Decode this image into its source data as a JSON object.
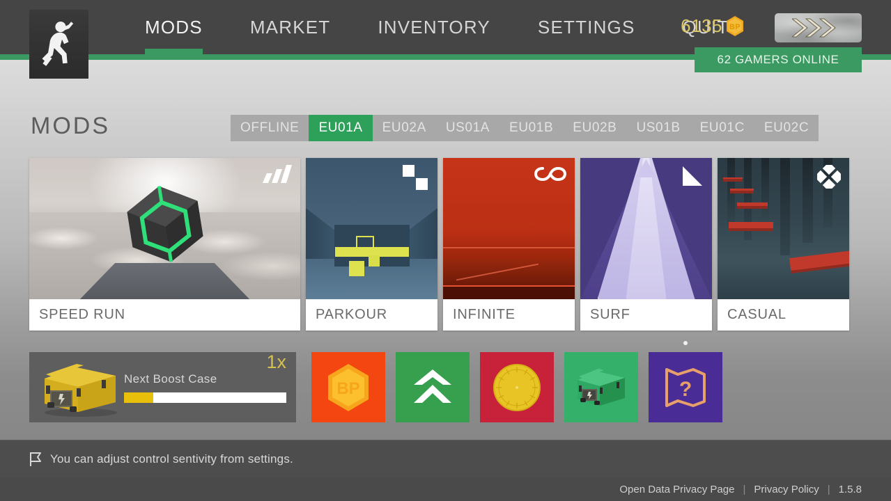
{
  "header": {
    "logo_icon": "running-man-logo",
    "nav": [
      {
        "label": "MODS",
        "active": true
      },
      {
        "label": "MARKET",
        "active": false
      },
      {
        "label": "INVENTORY",
        "active": false
      },
      {
        "label": "SETTINGS",
        "active": false
      },
      {
        "label": "QUIT",
        "active": false
      }
    ],
    "currency": {
      "amount": "6135",
      "icon": "bp-hexagon-icon",
      "icon_text": "BP",
      "color": "#d9c567"
    },
    "avatar": {
      "icon": "rank-chevrons-badge"
    },
    "online_badge": {
      "text": "62 GAMERS ONLINE",
      "color": "#3b9a62"
    }
  },
  "page": {
    "title": "MODS",
    "server_tabs": [
      {
        "label": "OFFLINE",
        "active": false
      },
      {
        "label": "EU01A",
        "active": true
      },
      {
        "label": "EU02A",
        "active": false
      },
      {
        "label": "US01A",
        "active": false
      },
      {
        "label": "EU01B",
        "active": false
      },
      {
        "label": "EU02B",
        "active": false
      },
      {
        "label": "US01B",
        "active": false
      },
      {
        "label": "EU01C",
        "active": false
      },
      {
        "label": "EU02C",
        "active": false
      }
    ]
  },
  "modes": [
    {
      "label": "SPEED RUN",
      "badge_icon": "three-bars-icon",
      "accent": "#2fe07a"
    },
    {
      "label": "PARKOUR",
      "badge_icon": "two-squares-icon",
      "accent": "#dde24e"
    },
    {
      "label": "INFINITE",
      "badge_icon": "infinity-icon",
      "accent": "#c63418"
    },
    {
      "label": "SURF",
      "badge_icon": "triangle-icon",
      "accent": "#5b4b96"
    },
    {
      "label": "CASUAL",
      "badge_icon": "four-diamonds-icon",
      "accent": "#c0392b"
    }
  ],
  "boost": {
    "icon": "yellow-case-icon",
    "title": "Next Boost Case",
    "multiplier": "1x",
    "progress_percent": 18
  },
  "tiles": [
    {
      "name": "battle-pass-tile",
      "icon": "bp-hexagon-icon",
      "icon_text": "BP",
      "color": "#f44611",
      "dot": false
    },
    {
      "name": "upgrade-tile",
      "icon": "double-chevron-up-icon",
      "color": "#37a04f",
      "dot": false
    },
    {
      "name": "wheel-tile",
      "icon": "spin-wheel-icon",
      "color": "#c72239",
      "dot": false
    },
    {
      "name": "case-tile",
      "icon": "green-case-icon",
      "color": "#35b06a",
      "dot": false
    },
    {
      "name": "mystery-map-tile",
      "icon": "map-question-icon",
      "color": "#4a2c96",
      "dot": true
    }
  ],
  "tip": {
    "icon": "flag-icon",
    "text": "You can adjust control sentivity from settings."
  },
  "footer": {
    "links": [
      "Open Data Privacy Page",
      "Privacy Policy"
    ],
    "separator": "|",
    "version": "1.5.8"
  }
}
